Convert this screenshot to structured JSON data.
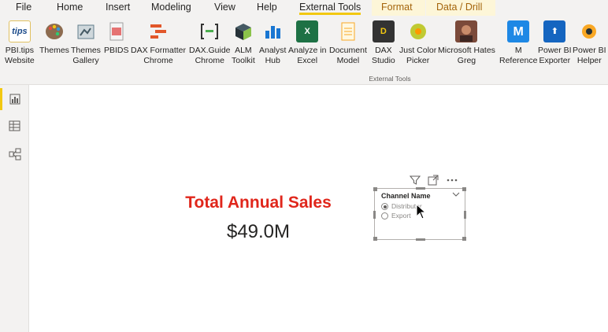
{
  "menu": {
    "tabs": [
      {
        "label": "File"
      },
      {
        "label": "Home"
      },
      {
        "label": "Insert"
      },
      {
        "label": "Modeling"
      },
      {
        "label": "View"
      },
      {
        "label": "Help"
      },
      {
        "label": "External Tools",
        "active": true
      },
      {
        "label": "Format",
        "contextual": true
      },
      {
        "label": "Data / Drill",
        "contextual": true
      }
    ]
  },
  "ribbon": {
    "group_label": "External Tools",
    "buttons": [
      {
        "line1": "PBI.tips",
        "line2": "Website",
        "icon": "pbi-tips-icon"
      },
      {
        "line1": "Themes",
        "line2": "",
        "icon": "palette-icon"
      },
      {
        "line1": "Themes",
        "line2": "Gallery",
        "icon": "themes-gallery-icon"
      },
      {
        "line1": "PBIDS",
        "line2": "",
        "icon": "pbids-icon"
      },
      {
        "line1": "DAX Formatter",
        "line2": "Chrome",
        "icon": "dax-formatter-icon"
      },
      {
        "line1": "DAX.Guide",
        "line2": "Chrome",
        "icon": "dax-guide-icon"
      },
      {
        "line1": "ALM",
        "line2": "Toolkit",
        "icon": "alm-toolkit-icon"
      },
      {
        "line1": "Analyst",
        "line2": "Hub",
        "icon": "analyst-hub-icon"
      },
      {
        "line1": "Analyze in",
        "line2": "Excel",
        "icon": "excel-icon"
      },
      {
        "line1": "Document",
        "line2": "Model",
        "icon": "document-model-icon"
      },
      {
        "line1": "DAX",
        "line2": "Studio",
        "icon": "dax-studio-icon"
      },
      {
        "line1": "Just Color",
        "line2": "Picker",
        "icon": "color-picker-icon"
      },
      {
        "line1": "Microsoft Hates",
        "line2": "Greg",
        "icon": "greg-photo-icon"
      },
      {
        "line1": "M",
        "line2": "Reference",
        "icon": "m-reference-icon"
      },
      {
        "line1": "Power BI",
        "line2": "Exporter",
        "icon": "exporter-icon"
      },
      {
        "line1": "Power BI",
        "line2": "Helper",
        "icon": "helper-icon"
      }
    ]
  },
  "leftnav": [
    {
      "icon": "report-view-icon",
      "active": true
    },
    {
      "icon": "data-view-icon"
    },
    {
      "icon": "model-view-icon"
    }
  ],
  "card": {
    "title": "Total Annual Sales",
    "value": "$49.0M",
    "title_color": "#e0261b"
  },
  "slicer": {
    "header": "Channel Name",
    "options": [
      {
        "label": "Distributor",
        "selected": true
      },
      {
        "label": "Export",
        "selected": false
      }
    ]
  },
  "colors": {
    "accent": "#f2c811",
    "ribbon_bg": "#f3f2f1"
  }
}
